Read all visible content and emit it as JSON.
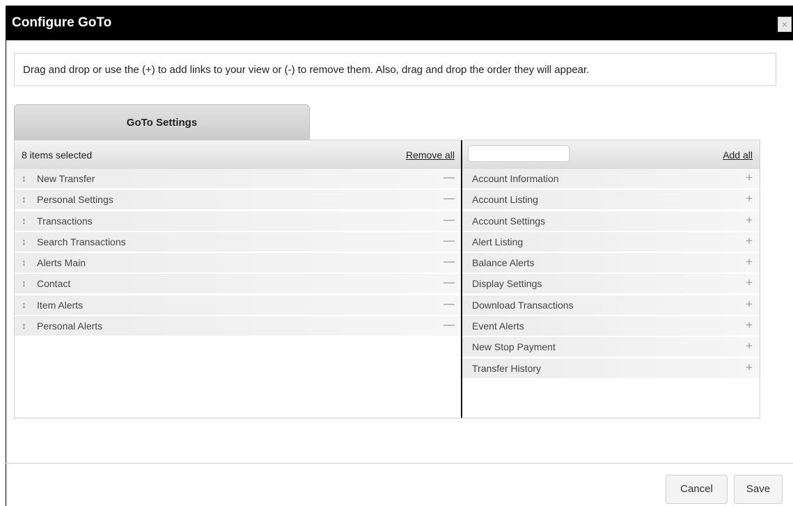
{
  "dialog": {
    "title": "Configure GoTo",
    "close_symbol": "×",
    "instructions": "Drag and drop or use the (+) to add links to your view or (-) to remove them. Also, drag and drop the order they will appear."
  },
  "tab": {
    "label": "GoTo Settings"
  },
  "selected": {
    "count_text": "8 items selected",
    "remove_all_label": "Remove all",
    "drag_symbol": "↕",
    "remove_symbol": "—",
    "items": [
      {
        "label": "New Transfer"
      },
      {
        "label": "Personal Settings"
      },
      {
        "label": "Transactions"
      },
      {
        "label": "Search Transactions"
      },
      {
        "label": "Alerts Main"
      },
      {
        "label": "Contact"
      },
      {
        "label": "Item Alerts"
      },
      {
        "label": "Personal Alerts"
      }
    ]
  },
  "available": {
    "filter_value": "",
    "add_all_label": "Add all",
    "add_symbol": "+",
    "items": [
      {
        "label": "Account Information"
      },
      {
        "label": "Account Listing"
      },
      {
        "label": "Account Settings"
      },
      {
        "label": "Alert Listing"
      },
      {
        "label": "Balance Alerts"
      },
      {
        "label": "Display Settings"
      },
      {
        "label": "Download Transactions"
      },
      {
        "label": "Event Alerts"
      },
      {
        "label": "New Stop Payment"
      },
      {
        "label": "Transfer History"
      }
    ]
  },
  "footer": {
    "cancel_label": "Cancel",
    "save_label": "Save"
  }
}
